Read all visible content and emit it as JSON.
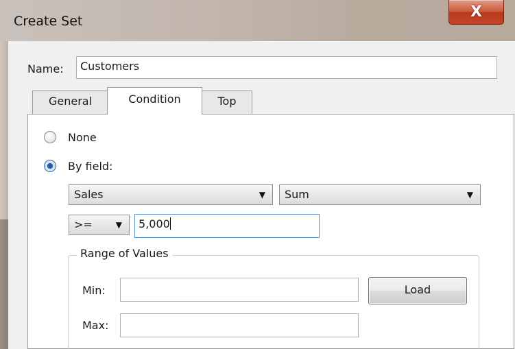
{
  "window": {
    "title": "Create Set",
    "close_label": "X"
  },
  "name_field": {
    "label": "Name:",
    "value": "Customers"
  },
  "tabs": [
    {
      "label": "General",
      "active": false
    },
    {
      "label": "Condition",
      "active": true
    },
    {
      "label": "Top",
      "active": false
    }
  ],
  "condition": {
    "option_none": {
      "label": "None",
      "selected": false
    },
    "option_by_field": {
      "label": "By field:",
      "selected": true
    },
    "field_select": {
      "value": "Sales"
    },
    "aggregation_select": {
      "value": "Sum"
    },
    "operator_select": {
      "value": ">="
    },
    "value_input": {
      "value": "5,000"
    },
    "range": {
      "legend": "Range of Values",
      "min_label": "Min:",
      "min_value": "",
      "max_label": "Max:",
      "max_value": "",
      "load_label": "Load"
    }
  },
  "icons": {
    "dropdown": "chevron-down-icon",
    "close": "close-icon"
  },
  "colors": {
    "close_button": "#c4452a",
    "radio_selected": "#2e6cb8",
    "focus_border": "#5b8fc7"
  }
}
